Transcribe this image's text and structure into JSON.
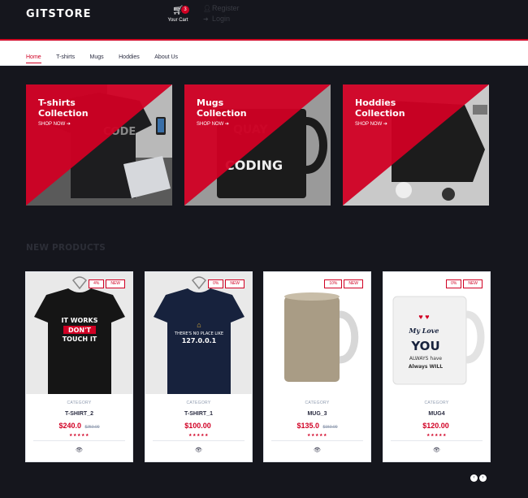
{
  "header": {
    "logo": "GITSTORE",
    "cart": {
      "count": "3",
      "label": "Your Cart",
      "icon": "cart-icon"
    },
    "account": {
      "register": "Register",
      "login": "Login"
    }
  },
  "nav": {
    "items": [
      "Home",
      "T-shirts",
      "Mugs",
      "Hoddies",
      "About Us"
    ],
    "active": "Home"
  },
  "collections": [
    {
      "line1": "T-shirts",
      "line2": "Collection",
      "cta": "SHOP NOW"
    },
    {
      "line1": "Mugs",
      "line2": "Collection",
      "cta": "SHOP NOW"
    },
    {
      "line1": "Hoddies",
      "line2": "Collection",
      "cta": "SHOP NOW"
    }
  ],
  "section_title": "NEW PRODUCTS",
  "products": [
    {
      "sale": "4%",
      "new": "NEW",
      "category": "CATEGORY",
      "name": "T-SHIRT_2",
      "price": "$240.0",
      "old_price": "$250.00",
      "rating": 5,
      "print": [
        "IT WORKS",
        "DON'T",
        "TOUCH IT"
      ]
    },
    {
      "sale": "0%",
      "new": "NEW",
      "category": "CATEGORY",
      "name": "T-SHIRT_1",
      "price": "$100.00",
      "old_price": "",
      "rating": 5,
      "print": [
        "THERE'S NO PLACE LIKE",
        "127.0.0.1"
      ]
    },
    {
      "sale": "10%",
      "new": "NEW",
      "category": "CATEGORY",
      "name": "MUG_3",
      "price": "$135.0",
      "old_price": "$150.00",
      "rating": 5
    },
    {
      "sale": "0%",
      "new": "NEW",
      "category": "CATEGORY",
      "name": "MUG4",
      "price": "$120.00",
      "old_price": "",
      "rating": 5,
      "print": [
        "My Love",
        "YOU",
        "ALWAYS have",
        "Always WILL"
      ]
    }
  ],
  "colors": {
    "accent": "#d10024",
    "dark": "#15161d",
    "text": "#2b2d42",
    "muted": "#8d99ae"
  }
}
